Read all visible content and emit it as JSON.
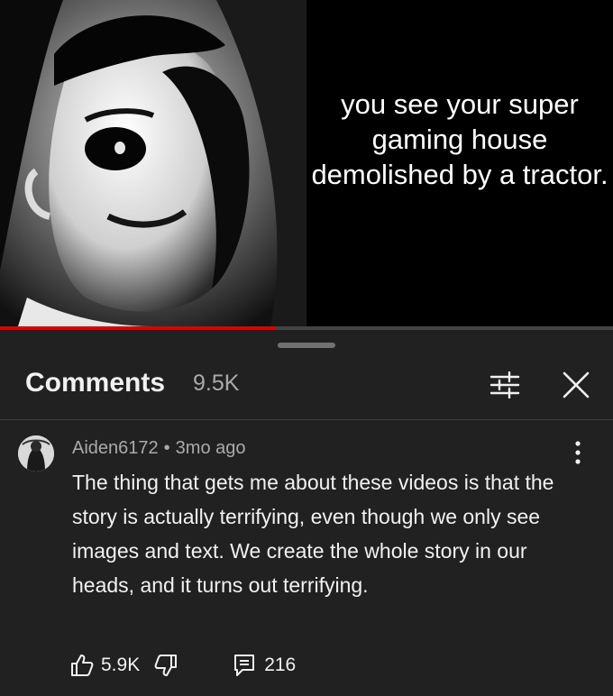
{
  "video": {
    "caption": "you see your super gaming house demolished by a tractor.",
    "progress_fraction": 0.45,
    "progress_color": "#e00000"
  },
  "comments_panel": {
    "title": "Comments",
    "count": "9.5K",
    "filter_icon": "filter-sliders-icon",
    "close_icon": "close-icon"
  },
  "comment": {
    "author": "Aiden6172",
    "time": "3mo ago",
    "text": "The thing that gets me about these videos is that the story is actually terrifying, even though we only see images and text. We create the whole story in our heads, and it turns out terrifying.",
    "likes": "5.9K",
    "replies": "216"
  }
}
